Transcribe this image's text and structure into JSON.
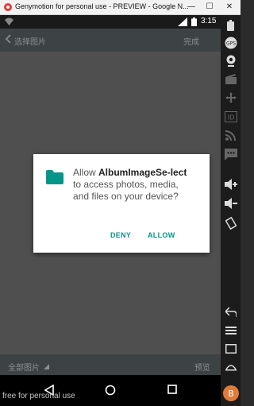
{
  "window": {
    "title": "Genymotion for personal use - PREVIEW - Google N...",
    "minimize_glyph": "—",
    "maximize_glyph": "☐",
    "close_glyph": "✕"
  },
  "status_bar": {
    "time": "3:15"
  },
  "app_bar": {
    "title": "选择图片",
    "done": "完成"
  },
  "dialog": {
    "prefix": "Allow ",
    "app_name": "AlbumImageSe-lect",
    "suffix": " to access photos, media, and files on your device?",
    "deny": "DENY",
    "allow": "ALLOW",
    "accent_color": "#009688"
  },
  "bottom_bar": {
    "albums": "全部图片",
    "preview": "预览"
  },
  "watermark": "free for personal use",
  "sidebar": {
    "gps_label": "GPS",
    "id_label": "ID"
  },
  "avatar_text": "B"
}
